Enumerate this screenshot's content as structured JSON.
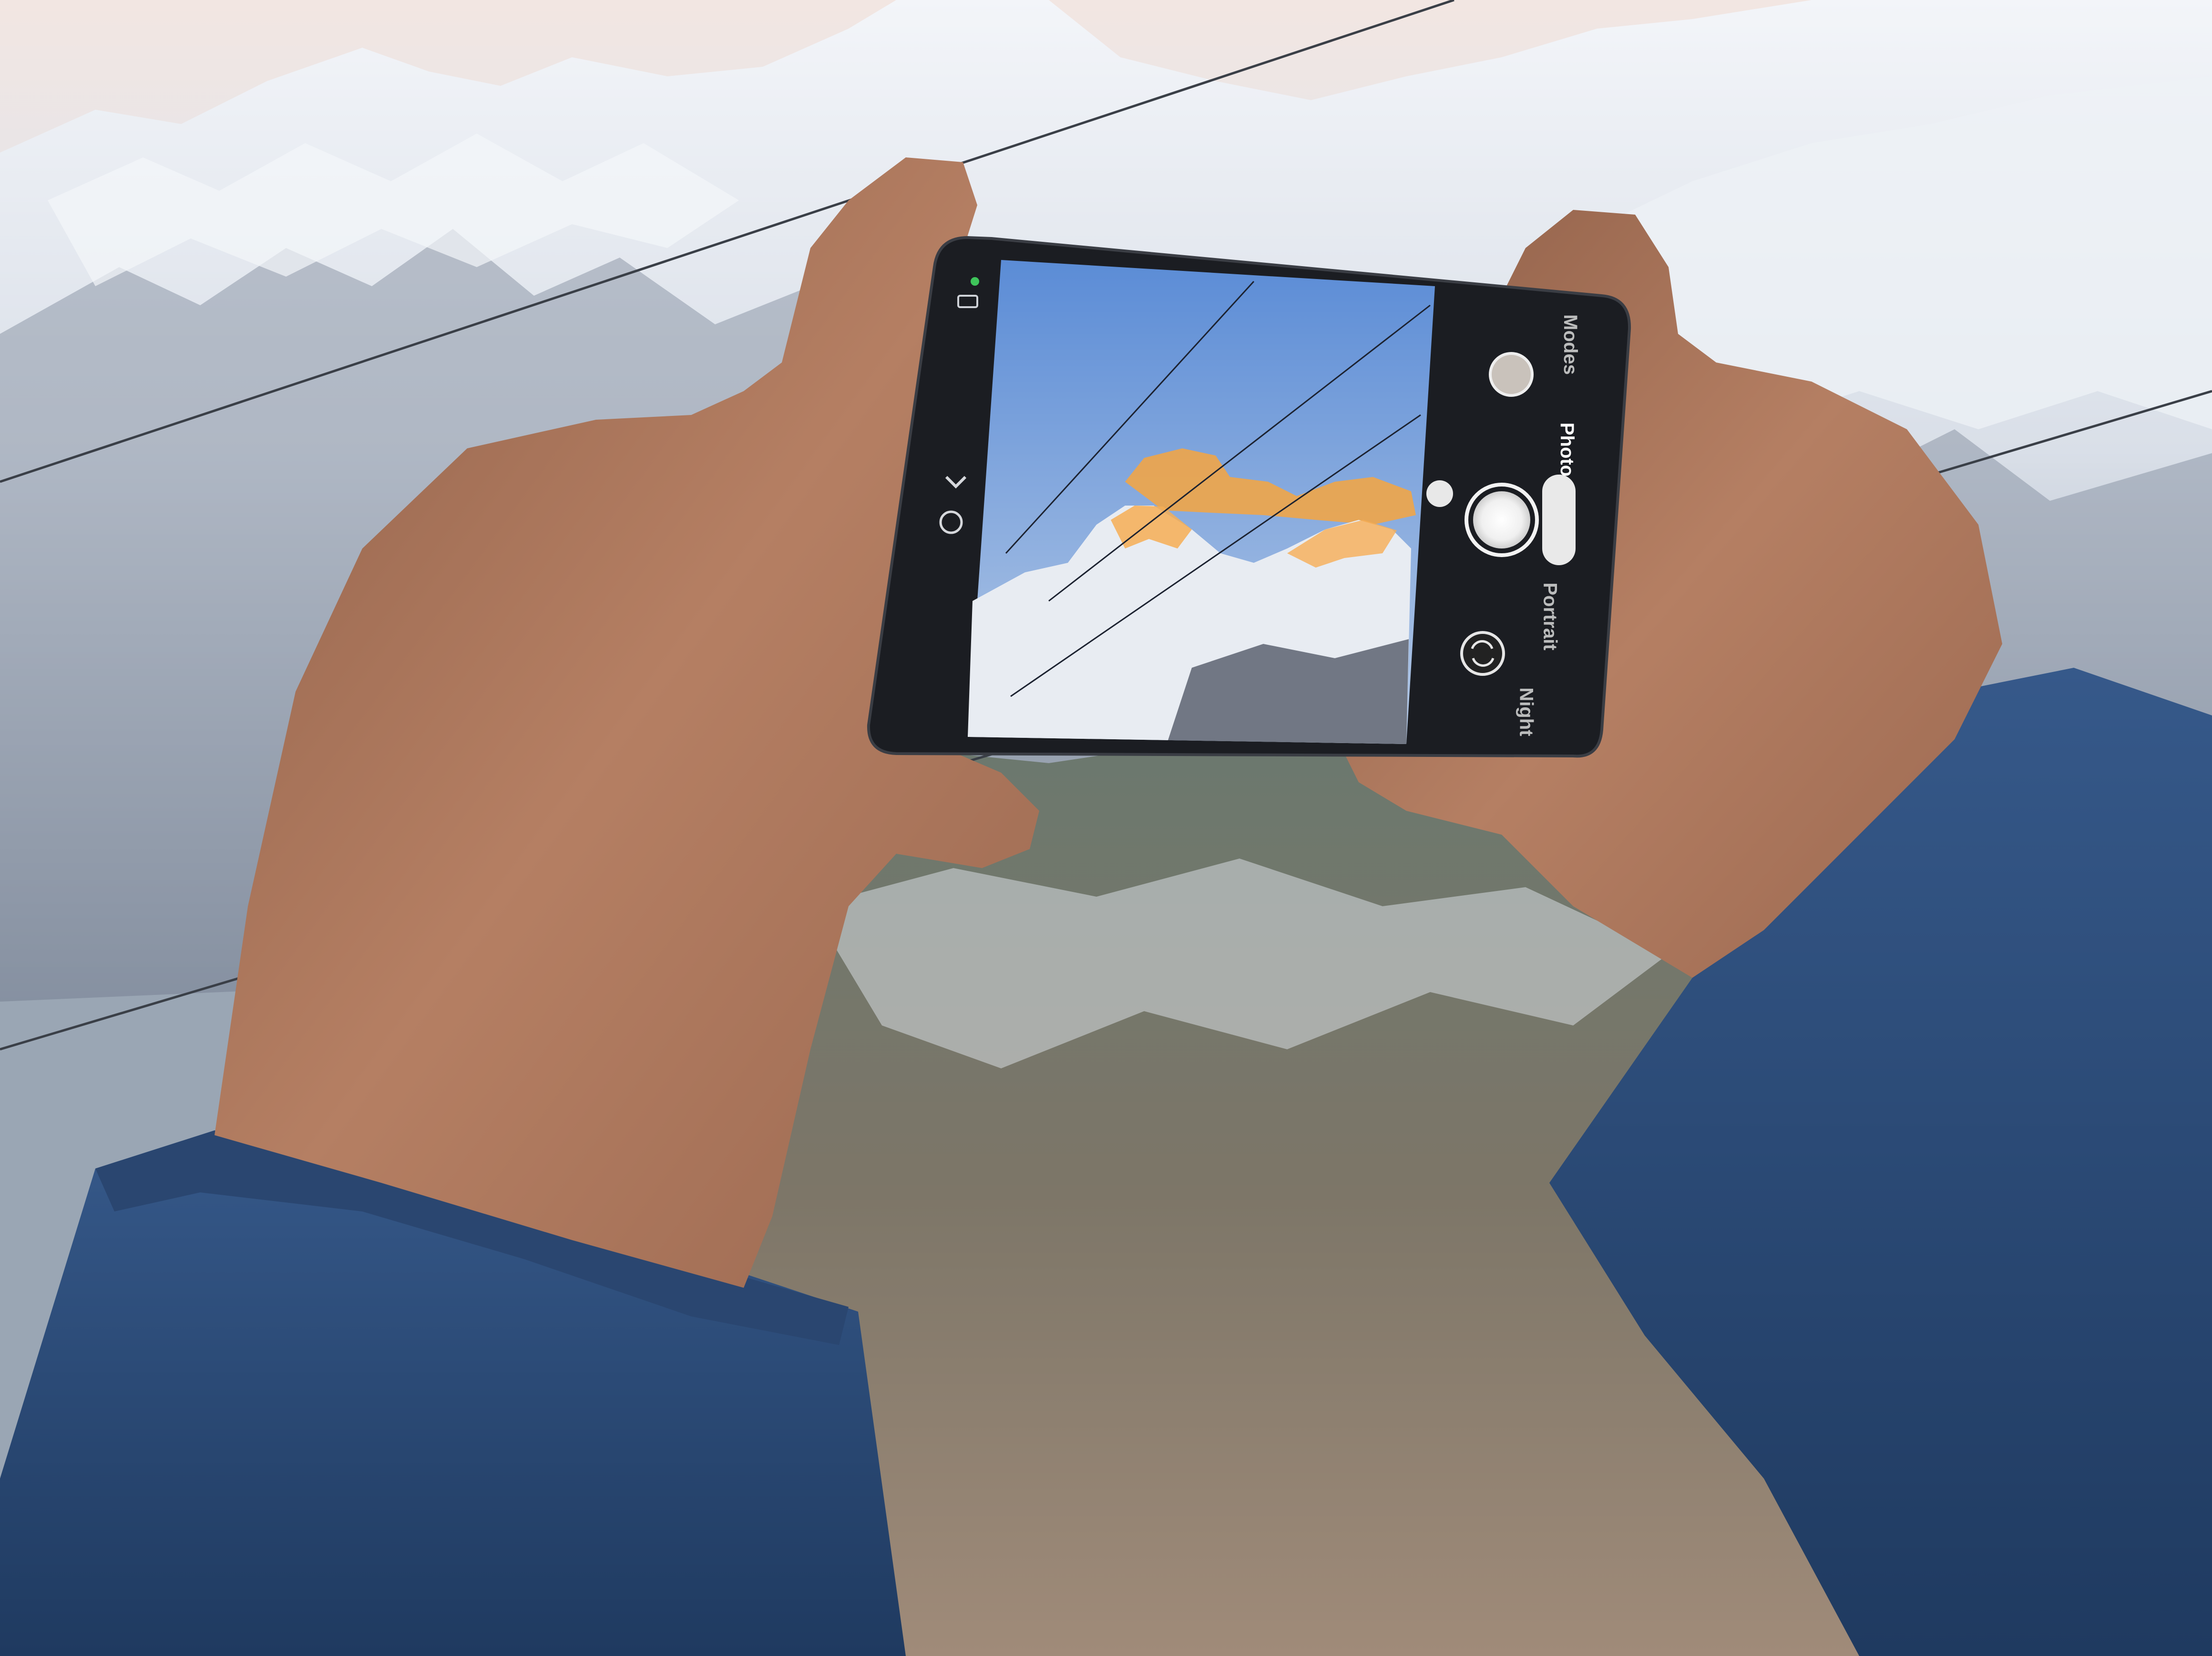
{
  "camera_ui": {
    "modes": [
      {
        "label": "Modes",
        "active": false
      },
      {
        "label": "Photo",
        "active": true
      },
      {
        "label": "Portrait",
        "active": false
      },
      {
        "label": "Night",
        "active": false
      }
    ],
    "icons": [
      "gallery-thumbnail-icon",
      "shutter-button-icon",
      "switch-camera-icon",
      "settings-chevron-icon",
      "flash-icon",
      "battery-icon"
    ]
  },
  "colors": {
    "sky_top": "#dfe6ee",
    "snow": "#eef2f7",
    "rock_shadow": "#6b7686",
    "forest": "#4c5a4e",
    "earth": "#a08a78",
    "skin": "#a9755c",
    "sleeve": "#2c4a74",
    "phone_body": "#1a1c20",
    "screen_sky_top": "#5d8fd6",
    "screen_sky_bottom": "#b7cce6",
    "cloud_glow": "#f0a64a",
    "peak_glow": "#f7b056"
  }
}
